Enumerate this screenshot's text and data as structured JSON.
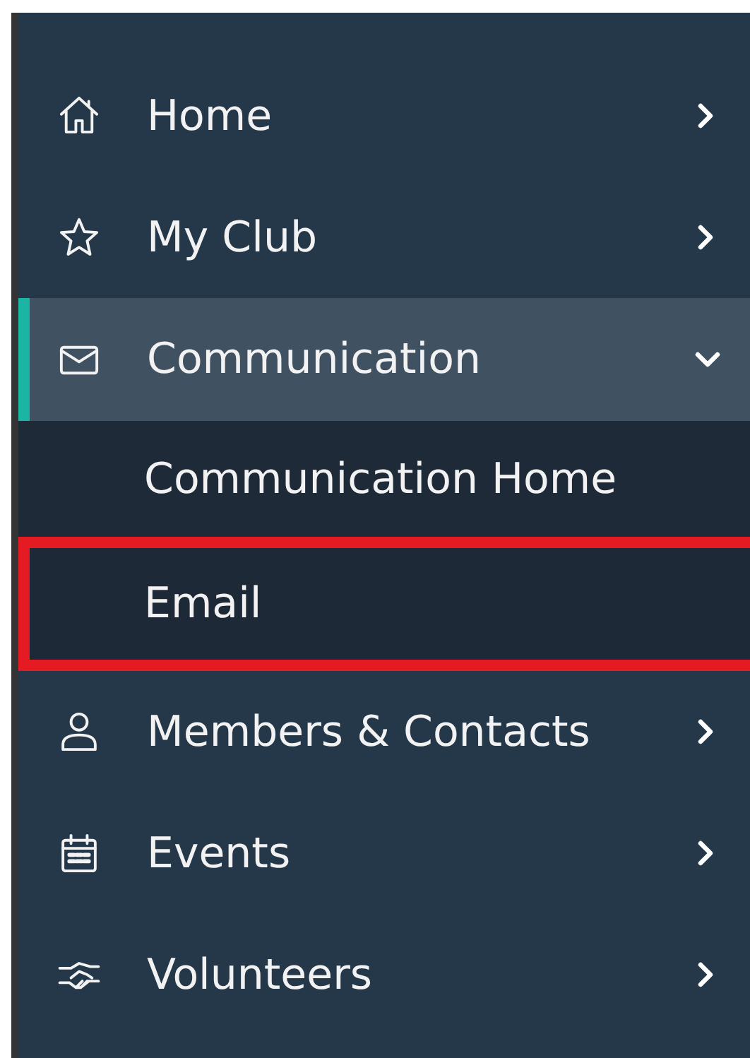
{
  "menu": [
    {
      "label": "Home",
      "selected": false,
      "expanded": false
    },
    {
      "label": "My Club",
      "selected": false,
      "expanded": false
    },
    {
      "label": "Communication",
      "selected": true,
      "expanded": true,
      "children": [
        {
          "label": "Communication Home",
          "highlighted": false
        },
        {
          "label": "Email",
          "highlighted": true
        }
      ]
    },
    {
      "label": "Members & Contacts",
      "selected": false,
      "expanded": false
    },
    {
      "label": "Events",
      "selected": false,
      "expanded": false
    },
    {
      "label": "Volunteers",
      "selected": false,
      "expanded": false
    }
  ]
}
